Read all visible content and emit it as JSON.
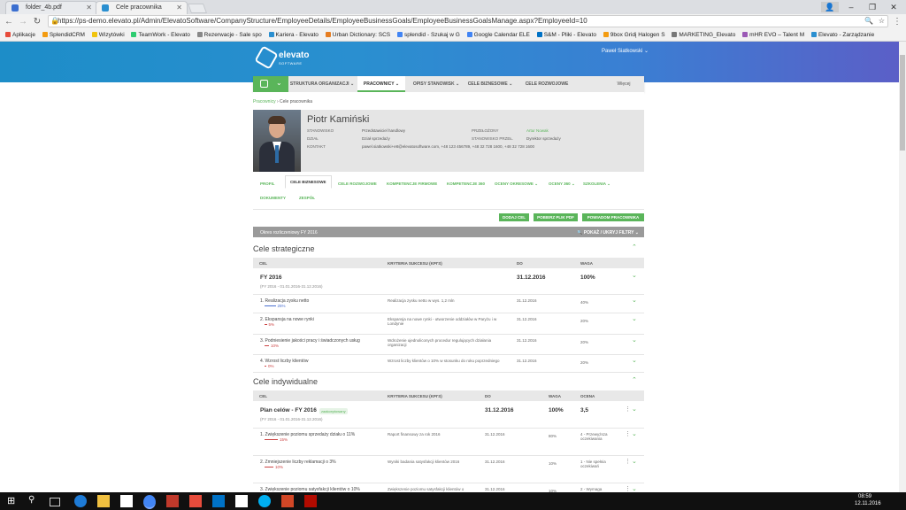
{
  "browser": {
    "tabs": [
      {
        "title": "folder_4b.pdf",
        "active": false
      },
      {
        "title": "Cele pracownika",
        "active": true
      }
    ],
    "url": "https://ps-demo.elevato.pl/Admin/ElevatoSoftware/CompanyStructure/EmployeeDetails/EmployeeBusinessGoals/EmployeeBusinessGoalsManage.aspx?EmployeeId=10",
    "bookmarks": [
      "Aplikacje",
      "SplendidCRM",
      "Wizytówki",
      "TeamWork - Elevato",
      "Rezerwacje - Sale spo",
      "Kariera - Elevato",
      "Urban Dictionary: SCS",
      "splendid - Szukaj w G",
      "Google Calendar ELE",
      "S&M - Pliki - Elevato",
      "9box Gridį Halogen S",
      "MARKETING_Elevato",
      "mHR EVO – Talent M",
      "Elevato - Zarządzanie"
    ]
  },
  "app": {
    "logo_text": "elevato",
    "logo_sub": "SOFTWARE",
    "user": "Paweł Siatkowski",
    "nav": [
      "STRUKTURA ORGANIZACJI",
      "PRACOWNICY",
      "OPISY STANOWISK",
      "CELE BIZNESOWE",
      "CELE ROZWOJOWE",
      "Więcej"
    ],
    "breadcrumb": [
      "Pracownicy",
      "Cele pracownika"
    ],
    "profile": {
      "name": "Piotr Kamiński",
      "labels": {
        "position": "STANOWISKO",
        "dept": "DZIAŁ",
        "contact": "KONTAKT",
        "manager": "PRZEŁOŻONY",
        "manager_pos": "STANOWISKO PRZEŁ."
      },
      "position": "Przedstawiciel handlowy",
      "dept": "Dział sprzedaży",
      "contact": "pawel.siatkowski+e8@elevatosoftware.com, +48 123 456789, +48 32 728 1600, +48 32 728 1600",
      "manager": "Artur Nowak",
      "manager_pos": "Dyrektor sprzedaży"
    },
    "tabs": [
      "PROFIL",
      "CELE BIZNESOWE",
      "CELE ROZWOJOWE",
      "KOMPETENCJE FIRMOWE",
      "KOMPETENCJE 360",
      "OCENY OKRESOWE",
      "OCENY 360",
      "SZKOLENIA",
      "DOKUMENTY",
      "ZESPÓŁ"
    ],
    "buttons": [
      "DODAJ CEL",
      "POBIERZ PLIK PDF",
      "POWIADOM PRACOWNIKA"
    ],
    "period": "Okres rozliczeniowy FY 2016",
    "filters": "POKAŻ / UKRYJ FILTRY",
    "strategic": {
      "title": "Cele strategiczne",
      "headers": [
        "CEL",
        "KRYTERIA SUKCESU (KPI'S)",
        "DO",
        "WAGA"
      ],
      "group": {
        "title": "FY 2016",
        "sub": "(FY 2016 - 01.01.2016-31.12.2016)",
        "date": "31.12.2016",
        "weight": "100%"
      },
      "rows": [
        {
          "goal": "1. Realizacja zysku netto",
          "pct": "25%",
          "progress": 0.25,
          "kpi": "Realizacja zysku netto w wys. 1,2 mln",
          "date": "31.12.2016",
          "weight": "40%"
        },
        {
          "goal": "2. Ekspansja na nowe rynki",
          "pct": "5%",
          "progress": 0.05,
          "kpi": "Ekspansja na nowe rynki - utworzenie oddziałów w Paryżu i w Londynie",
          "date": "31.12.2016",
          "weight": "20%"
        },
        {
          "goal": "3. Podniesienie jakości pracy i świadczonych usług",
          "pct": "10%",
          "progress": 0.1,
          "kpi": "Wdrożenie ujednoliconych procedur regulujących działania organizacji",
          "date": "31.12.2016",
          "weight": "20%"
        },
        {
          "goal": "4. Wzrost liczby klientów",
          "pct": "0%",
          "progress": 0,
          "kpi": "Wzrost liczby klientów o 10% w stosunku do roku poprzedniego",
          "date": "31.12.2016",
          "weight": "20%"
        }
      ]
    },
    "individual": {
      "title": "Cele indywidualne",
      "headers": [
        "CEL",
        "KRYTERIA SUKCESU (KPI'S)",
        "DO",
        "WAGA",
        "OCENA"
      ],
      "group": {
        "title": "Plan celów - FY 2016",
        "badge": "zaakceptowany",
        "sub": "(FY 2016 - 01.01.2016-31.12.2016)",
        "date": "31.12.2016",
        "weight": "100%",
        "score": "3,5"
      },
      "rows": [
        {
          "goal": "1. Zwiększenie poziomu sprzedaży działu o 11%",
          "pct": "15%",
          "progress": 0.15,
          "kpi": "Raport finansowy za rok 2016",
          "date": "31.12.2016",
          "weight": "80%",
          "score": "4 - Przewyższa oczekiwania"
        },
        {
          "goal": "2. Zmniejszenie liczby reklamacji o 3%",
          "pct": "10%",
          "progress": 0.1,
          "kpi": "Wyniki badania satysfakcji klientów 2016",
          "date": "31.12.2016",
          "weight": "10%",
          "score": "1 - Nie spełnia oczekiwań"
        },
        {
          "goal": "3. Zwiększenie poziomu satysfakcji klientów o 10%",
          "kpi": "Zwiększenie poziomu satysfakcji klientów o",
          "date": "31.12.2016",
          "weight": "10%",
          "score": "2 - Wymaga"
        }
      ]
    }
  },
  "taskbar": {
    "time": "08:59",
    "date": "12.11.2016"
  }
}
